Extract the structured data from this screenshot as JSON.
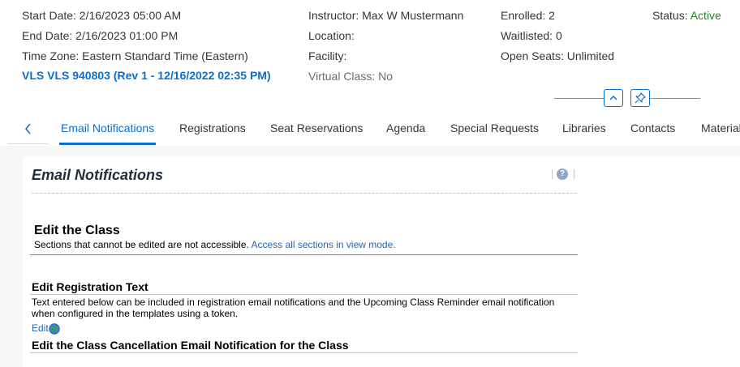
{
  "header": {
    "start_date": "Start Date: 2/16/2023 05:00 AM",
    "end_date": "End Date: 2/16/2023 01:00 PM",
    "time_zone": "Time Zone: Eastern Standard Time (Eastern)",
    "class_title": "VLS VLS 940803 (Rev 1 - 12/16/2022 02:35 PM)",
    "instructor": "Instructor: Max W Mustermann",
    "location": "Location:",
    "facility": "Facility:",
    "virtual_class": "Virtual Class: No",
    "enrolled": "Enrolled: 2",
    "waitlisted": "Waitlisted: 0",
    "open_seats": "Open Seats: Unlimited",
    "status_label": "Status:",
    "status_value": "Active"
  },
  "tabs": [
    {
      "label": "Email Notifications",
      "active": true
    },
    {
      "label": "Registrations",
      "active": false
    },
    {
      "label": "Seat Reservations",
      "active": false
    },
    {
      "label": "Agenda",
      "active": false
    },
    {
      "label": "Special Requests",
      "active": false
    },
    {
      "label": "Libraries",
      "active": false
    },
    {
      "label": "Contacts",
      "active": false
    },
    {
      "label": "Material",
      "active": false
    }
  ],
  "panel": {
    "title": "Email Notifications",
    "help_glyph": "?",
    "edit_class": {
      "title": "Edit the Class",
      "desc": "Sections that cannot be edited are not accessible.",
      "view_mode_link": "Access all sections in view mode."
    },
    "registration_text": {
      "title": "Edit Registration Text",
      "desc": "Text entered below can be included in registration email notifications and the Upcoming Class Reminder email notification when configured in the templates using a token.",
      "edit_label": "Edit"
    },
    "cancellation": {
      "title": "Edit the Class Cancellation Email Notification for the Class"
    }
  },
  "colors": {
    "accent": "#0a6ed1",
    "status_active": "#2b7d2b",
    "link": "#2a64ad"
  },
  "icons": {
    "back": "chevron-left-icon",
    "collapse": "chevron-up-icon",
    "pin": "pin-icon",
    "help": "help-icon",
    "globe": "globe-icon"
  }
}
